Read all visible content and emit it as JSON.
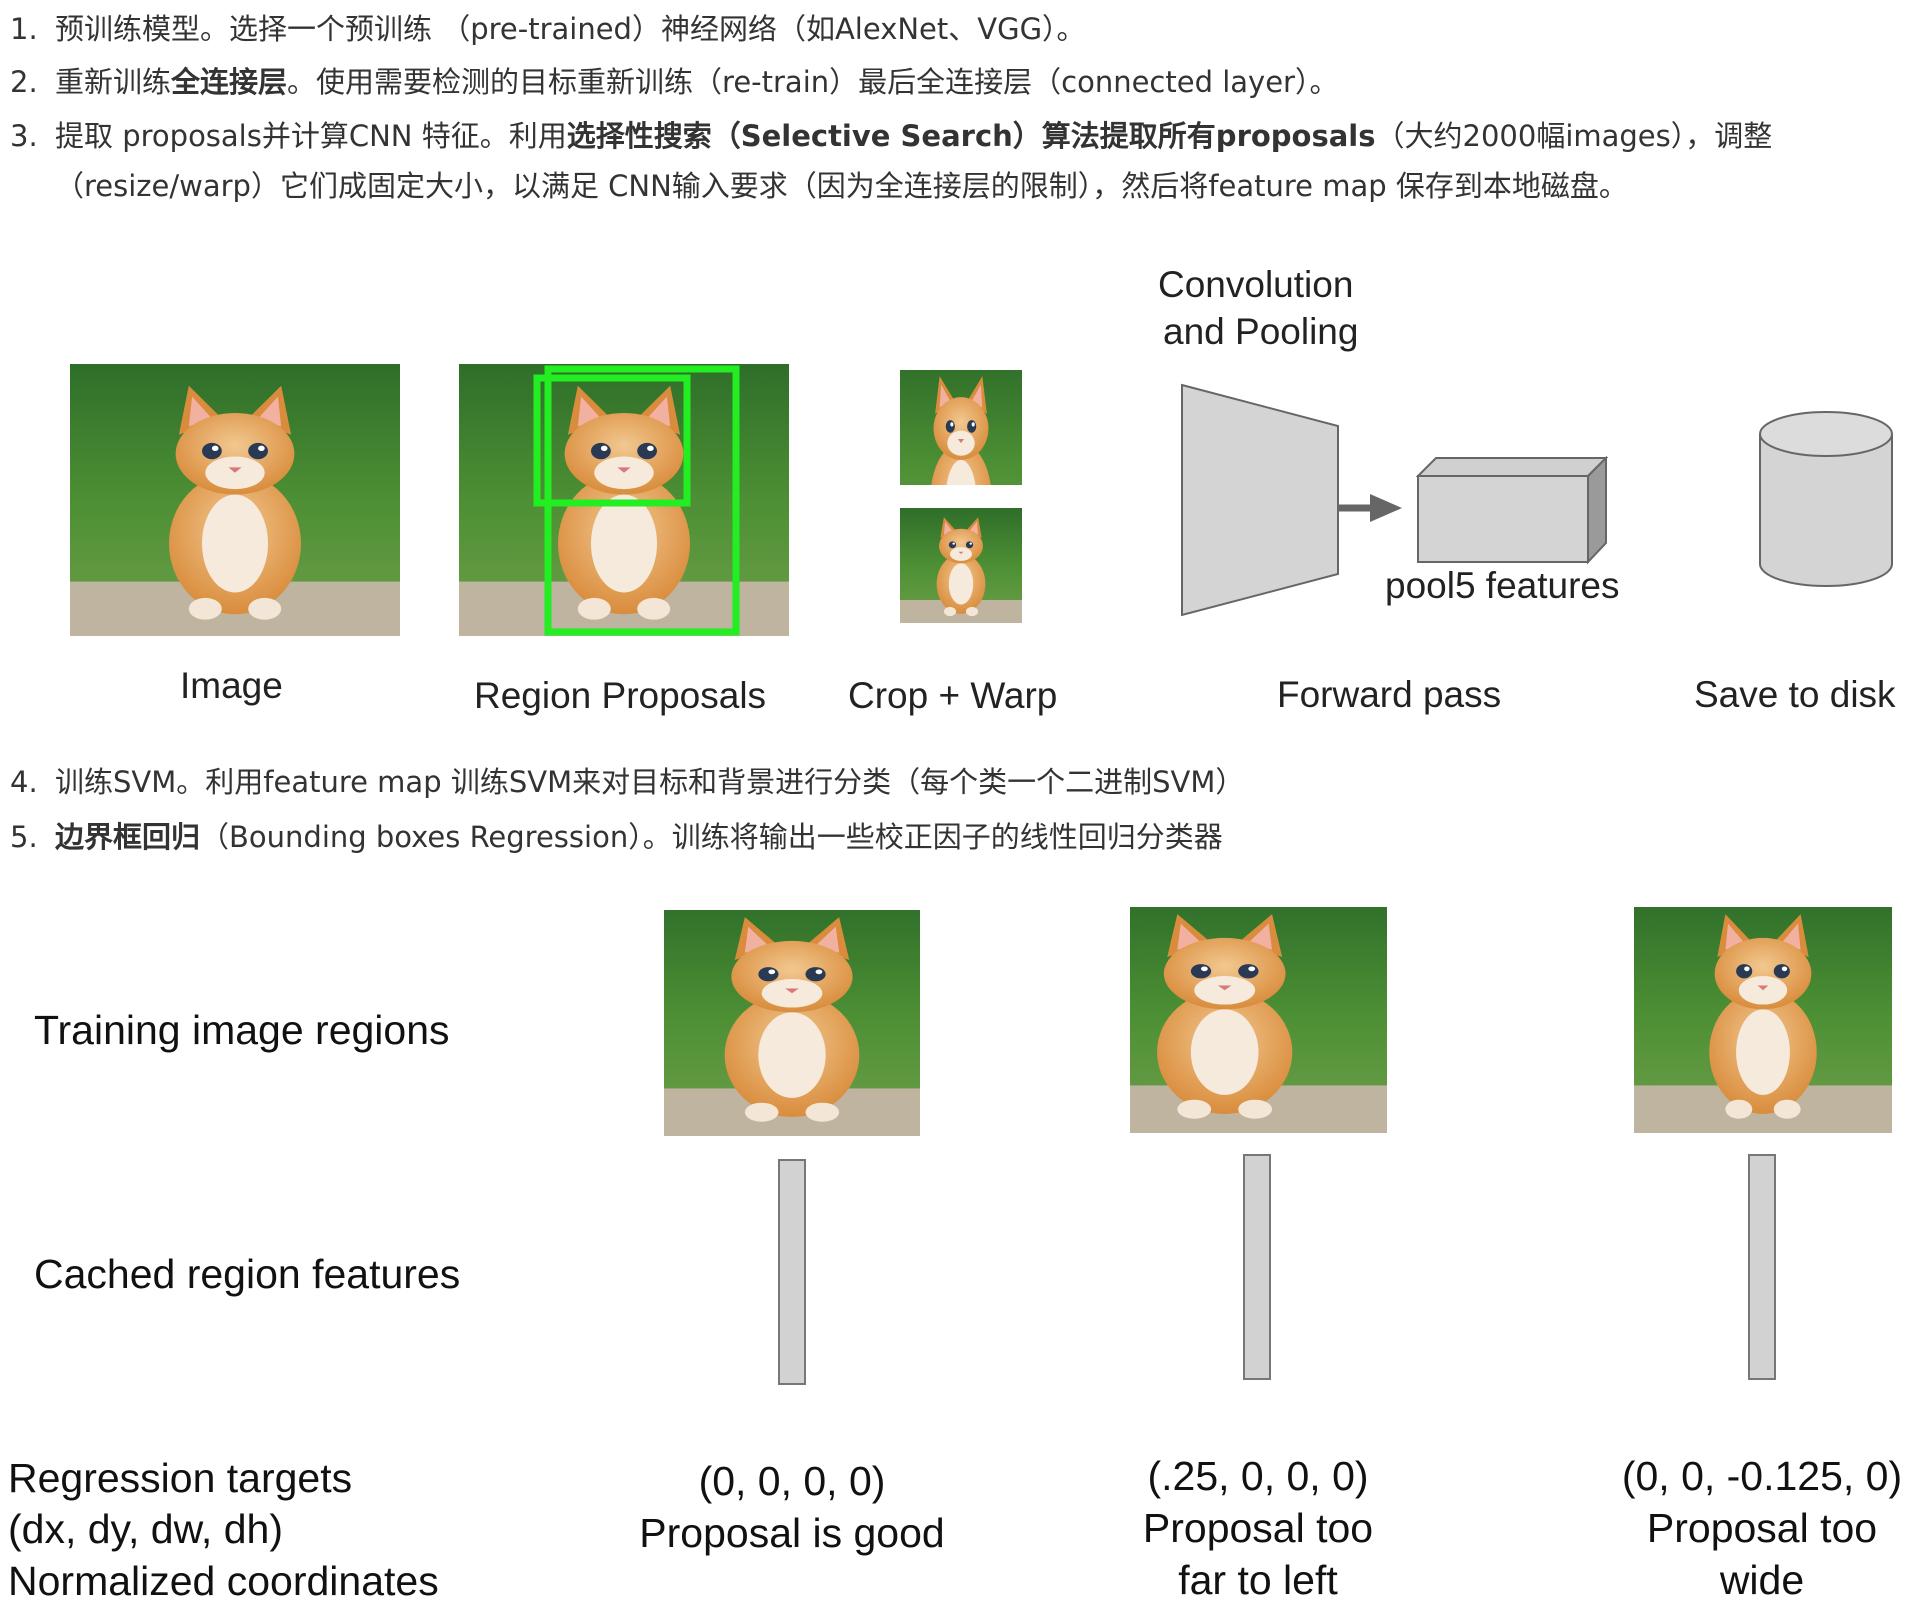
{
  "steps": [
    {
      "num": "1.",
      "parts": [
        {
          "t": "预训练模型。选择一个预训练 （pre-trained）神经网络（如AlexNet、VGG）。",
          "b": false
        }
      ]
    },
    {
      "num": "2.",
      "parts": [
        {
          "t": "重新训练",
          "b": false
        },
        {
          "t": "全连接层",
          "b": true
        },
        {
          "t": "。使用需要检测的目标重新训练（re-train）最后全连接层（connected layer）。",
          "b": false
        }
      ]
    },
    {
      "num": "3.",
      "parts": [
        {
          "t": "提取 proposals并计算CNN 特征。利用",
          "b": false
        },
        {
          "t": "选择性搜索（Selective Search）算法提取所有proposals",
          "b": true
        },
        {
          "t": "（大约2000幅images），调整（resize/warp）它们成固定大小，以满足 CNN输入要求（因为全连接层的限制），然后将feature map 保存到本地磁盘。",
          "b": false
        }
      ]
    },
    {
      "num": "4.",
      "parts": [
        {
          "t": "训练SVM。利用feature map 训练SVM来对目标和背景进行分类（每个类一个二进制SVM）",
          "b": false
        }
      ]
    },
    {
      "num": "5.",
      "parts": [
        {
          "t": "边界框回归",
          "b": true
        },
        {
          "t": "（Bounding boxes Regression）。训练将输出一些校正因子的线性回归分类器",
          "b": false
        }
      ]
    }
  ],
  "fig1": {
    "conv_title_1": "Convolution",
    "conv_title_2": "and Pooling",
    "pool5": "pool5 features",
    "captions": {
      "image": "Image",
      "region": "Region Proposals",
      "crop": "Crop + Warp",
      "forward": "Forward pass",
      "save": "Save to disk"
    }
  },
  "fig2": {
    "row_training": "Training image regions",
    "row_cached": "Cached region features",
    "row_regression": [
      "Regression targets",
      "(dx, dy, dw, dh)",
      "Normalized coordinates"
    ],
    "columns": [
      {
        "target": "(0, 0, 0, 0)",
        "desc1": "Proposal is good",
        "desc2": ""
      },
      {
        "target": "(.25, 0, 0, 0)",
        "desc1": "Proposal too",
        "desc2": "far to left"
      },
      {
        "target": "(0, 0, -0.125, 0)",
        "desc1": "Proposal too",
        "desc2": "wide"
      }
    ]
  },
  "colors": {
    "proposal_box": "#22ee22",
    "shape_fill": "#d4d4d4",
    "shape_stroke": "#666666"
  }
}
